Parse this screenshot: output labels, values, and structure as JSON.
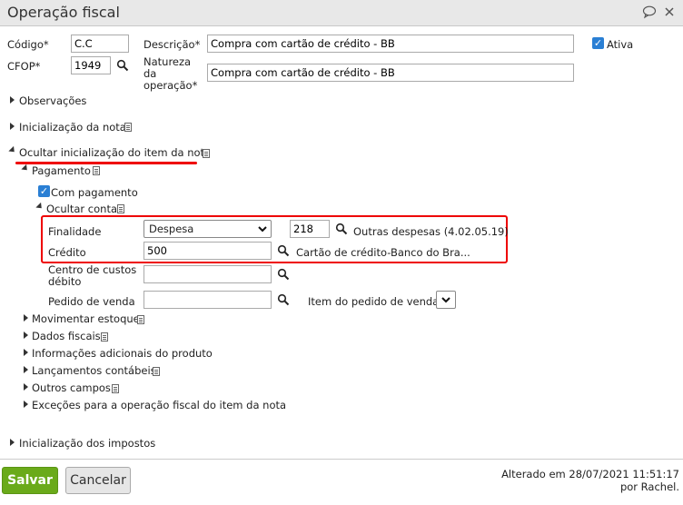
{
  "window": {
    "title": "Operação fiscal"
  },
  "header": {
    "codigo_label": "Código*",
    "codigo_value": "C.C",
    "descricao_label": "Descrição*",
    "descricao_value": "Compra com cartão de crédito - BB",
    "ativa_label": "Ativa",
    "cfop_label": "CFOP*",
    "cfop_value": "1949",
    "natureza_label_1": "Natureza",
    "natureza_label_2": "da",
    "natureza_label_3": "operação*",
    "natureza_value": "Compra com cartão de crédito - BB"
  },
  "sections": {
    "observacoes": "Observações",
    "inicializacao_nota": "Inicialização da nota",
    "ocultar_item": "Ocultar inicialização do item da nota",
    "pagamento": "Pagamento",
    "com_pagamento": "Com pagamento",
    "ocultar_conta": "Ocultar conta"
  },
  "conta": {
    "finalidade_label": "Finalidade",
    "finalidade_value": "Despesa",
    "finalidade_code": "218",
    "finalidade_desc": "Outras despesas (4.02.05.19)",
    "credito_label": "Crédito",
    "credito_value": "500",
    "credito_desc": "Cartão de crédito-Banco do Bra...",
    "centro_label_1": "Centro de custos",
    "centro_label_2": "débito",
    "pedido_label": "Pedido de venda",
    "item_pedido_label": "Item do pedido de venda"
  },
  "item_sections": [
    "Movimentar estoque",
    "Dados fiscais",
    "Informações adicionais do produto",
    "Lançamentos contábeis",
    "Outros campos",
    "Exceções para a operação fiscal do item da nota"
  ],
  "inicializacao_impostos": "Inicialização dos impostos",
  "footer": {
    "save_label": "Salvar",
    "cancel_label": "Cancelar",
    "altered_line1": "Alterado em 28/07/2021 11:51:17",
    "altered_line2": "por Rachel."
  },
  "colors": {
    "save": "#6aaa1a",
    "accent": "#2a7fd4",
    "highlight": "#e00000"
  }
}
